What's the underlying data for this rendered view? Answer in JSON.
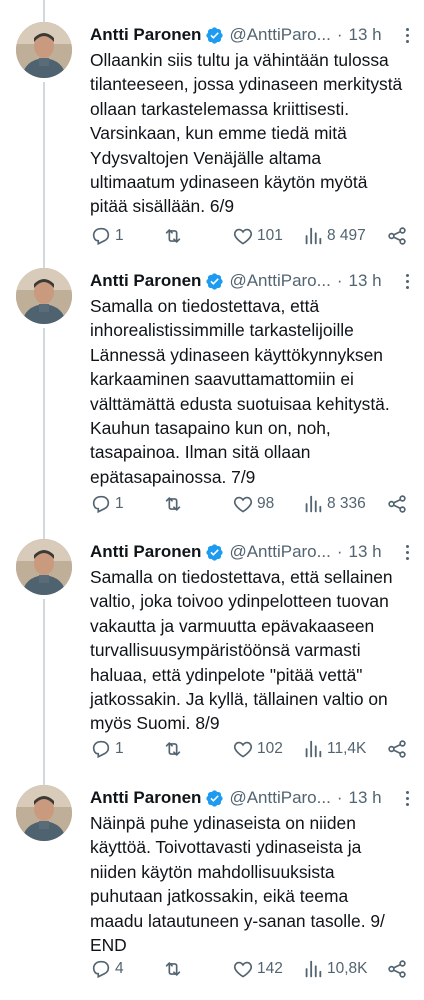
{
  "colors": {
    "accent": "#1d9bf0",
    "muted": "#536471",
    "text": "#0f1419",
    "line": "#cfd9de"
  },
  "tweets": [
    {
      "name": "Antti Paronen",
      "handle": "@AnttiParo...",
      "sep": "·",
      "time": "13 h",
      "text": "Ollaankin siis tultu ja vähintään tulossa\ntilanteeseen, jossa ydinaseen merkitystä\nollaan tarkastelemassa kriittisesti.\nVarsinkaan, kun emme tiedä mitä\nYdysvaltojen Venäjälle altama\nultimaatum ydinaseen käytön myötä\npitää sisällään. 6/9",
      "replies": "1",
      "retweets": "",
      "likes": "101",
      "views": "8 497"
    },
    {
      "name": "Antti Paronen",
      "handle": "@AnttiParo...",
      "sep": "·",
      "time": "13 h",
      "text": "Samalla on tiedostettava, että\ninhorealistissimmille tarkastelijoille\nLännessä ydinaseen käyttökynnyksen\nkarkaaminen saavuttamattomiin ei\nvälttämättä edusta suotuisaa kehitystä.\nKauhun tasapaino kun on, noh,\ntasapainoa. Ilman sitä ollaan\nepätasapainossa. 7/9",
      "replies": "1",
      "retweets": "",
      "likes": "98",
      "views": "8 336"
    },
    {
      "name": "Antti Paronen",
      "handle": "@AnttiParo...",
      "sep": "·",
      "time": "13 h",
      "text": "Samalla on tiedostettava, että sellainen\nvaltio, joka toivoo ydinpelotteen tuovan\nvakautta ja varmuutta epävakaaseen\nturvallisuusympäristöönsä varmasti\nhaluaa, että ydinpelote \"pitää vettä\"\njatkossakin. Ja kyllä, tällainen valtio on\nmyös Suomi. 8/9",
      "replies": "1",
      "retweets": "",
      "likes": "102",
      "views": "11,4K"
    },
    {
      "name": "Antti Paronen",
      "handle": "@AnttiParo...",
      "sep": "·",
      "time": "13 h",
      "text": "Näinpä puhe ydinaseista on niiden\nkäyttöä. Toivottavasti ydinaseista ja\nniiden käytön mahdollisuuksista\npuhutaan jatkossakin, eikä teema\nmaadu latautuneen y-sanan tasolle. 9/\nEND",
      "replies": "4",
      "retweets": "",
      "likes": "142",
      "views": "10,8K"
    }
  ]
}
